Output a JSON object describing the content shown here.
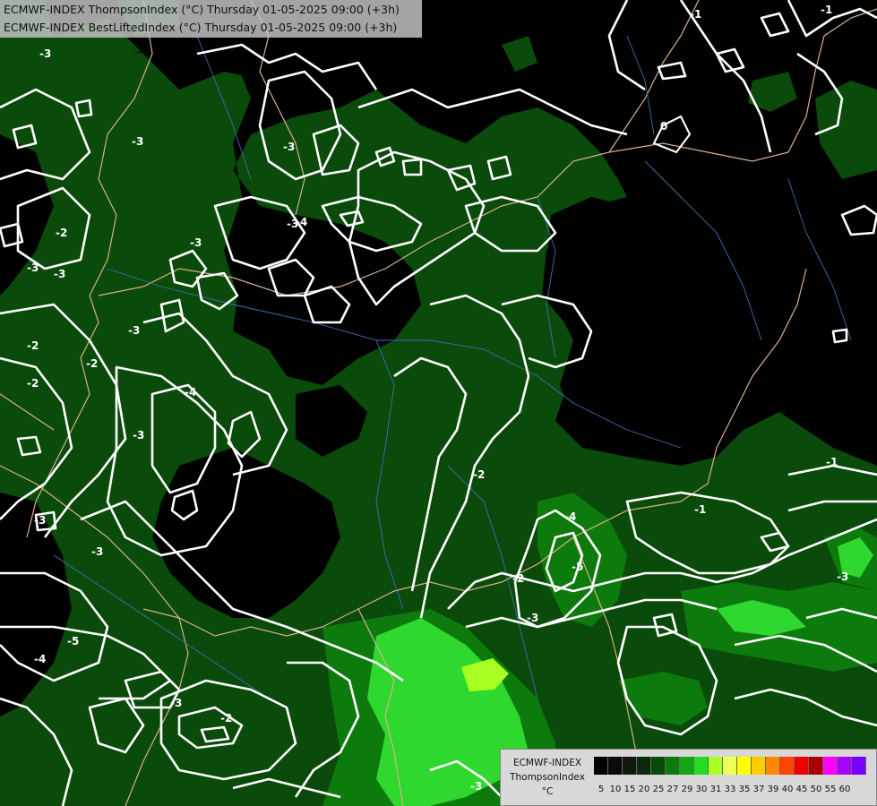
{
  "header": {
    "title_line1": "ECMWF-INDEX ThompsonIndex (°C) Thursday 01-05-2025 09:00 (+3h)",
    "title_line2": "ECMWF-INDEX BestLiftedIndex (°C) Thursday 01-05-2025 09:00 (+3h)"
  },
  "legend": {
    "line1": "ECMWF-INDEX",
    "line2": "ThompsonIndex",
    "line3": "°C",
    "ticks": [
      "5",
      "10",
      "15",
      "20",
      "25",
      "27",
      "29",
      "30",
      "31",
      "33",
      "35",
      "37",
      "39",
      "40",
      "45",
      "50",
      "55",
      "60"
    ],
    "colors": [
      "#000000",
      "#0a0a0a",
      "#101810",
      "#0d2a0d",
      "#0a4a0a",
      "#0c7a0c",
      "#11a811",
      "#22dd22",
      "#aaff22",
      "#eeff55",
      "#ffff00",
      "#ffcc00",
      "#ff8800",
      "#ff4400",
      "#ee0000",
      "#aa0000",
      "#ff00ff",
      "#aa00ff",
      "#7700ff",
      "#0000ff"
    ]
  },
  "contour_labels": [
    "-3",
    "-3",
    "-2",
    "-3",
    "-3",
    "-4",
    "-3",
    "-3",
    "-3",
    "-3",
    "-2",
    "-4",
    "-3",
    "-3",
    "-2",
    "-2",
    "-1",
    "0",
    "-1",
    "-4",
    "-5",
    "-3",
    "-5",
    "-4",
    "-3",
    "-2",
    "-3",
    "-2",
    "-2",
    "-1",
    "-3",
    "-3",
    "-1"
  ],
  "colors": {
    "dark_green": "#0a4a0a",
    "mid_green": "#0c7a0c",
    "bright_green": "#2ed82e",
    "lime": "#aaff22",
    "contour": "#ffffff",
    "border": "#d9b08c",
    "river": "#3d6fb5"
  }
}
